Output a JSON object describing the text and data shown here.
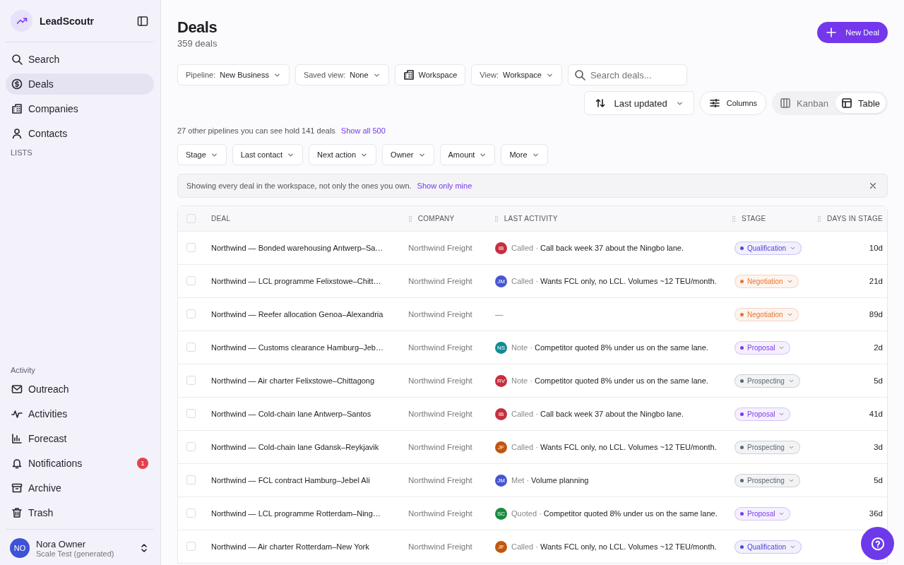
{
  "sidebar": {
    "brand": "LeadScoutr",
    "nav": [
      {
        "label": "Search",
        "selected": false
      },
      {
        "label": "Deals",
        "selected": true
      },
      {
        "label": "Companies",
        "selected": false
      },
      {
        "label": "Contacts",
        "selected": false
      }
    ],
    "lists_heading": "LISTS",
    "activity_heading": "Activity",
    "activity_nav": [
      {
        "label": "Outreach",
        "selected": false
      },
      {
        "label": "Activities",
        "selected": false
      },
      {
        "label": "Forecast",
        "selected": false
      },
      {
        "label": "Notifications",
        "selected": false,
        "badge": "1"
      },
      {
        "label": "Archive",
        "selected": false
      },
      {
        "label": "Trash",
        "selected": false
      }
    ],
    "user": {
      "initials": "NO",
      "name": "Nora Owner",
      "workspace": "Scale Test (generated)"
    }
  },
  "header": {
    "title": "Deals",
    "count": "359 deals",
    "new_button": "New Deal"
  },
  "toolbar": {
    "pipeline": {
      "label": "Pipeline:",
      "value": "New Business"
    },
    "saved_view": {
      "label": "Saved view:",
      "value": "None"
    },
    "workspace_button": "Workspace",
    "view": {
      "label": "View:",
      "value": "Workspace"
    },
    "search": {
      "placeholder": "Search deals..."
    },
    "sort": "Last updated",
    "columns_button": "Columns",
    "view_modes": [
      {
        "label": "Kanban",
        "selected": false
      },
      {
        "label": "Table",
        "selected": true
      }
    ]
  },
  "pipelines_note": {
    "text": "27 other pipelines you can see hold 141 deals",
    "link": "Show all 500"
  },
  "filters": [
    "Stage",
    "Last contact",
    "Next action",
    "Owner",
    "Amount",
    "More"
  ],
  "banner": {
    "text": "Showing every deal in the workspace, not only the ones you own.",
    "link": "Show only mine"
  },
  "table": {
    "all_checked": false,
    "columns": [
      "DEAL",
      "COMPANY",
      "LAST ACTIVITY",
      "STAGE",
      "DAYS IN STAGE"
    ],
    "rows": [
      {
        "checked": false,
        "deal": "Northwind — Bonded warehousing Antwerp–Sa…",
        "company": "Northwind Freight",
        "activity": {
          "initials": "IB",
          "color": "#c62f3e",
          "type": "Called ·",
          "text": "Call back week 37 about the Ningbo lane."
        },
        "stage": {
          "label": "Qualification",
          "color": "#5146d8"
        },
        "days": "10d"
      },
      {
        "checked": false,
        "deal": "Northwind — LCL programme Felixstowe–Chitt…",
        "company": "Northwind Freight",
        "activity": {
          "initials": "JM",
          "color": "#4656d0",
          "type": "Called ·",
          "text": "Wants FCL only, no LCL. Volumes ~12 TEU/month."
        },
        "stage": {
          "label": "Negotiation",
          "color": "#e8772e"
        },
        "days": "21d"
      },
      {
        "checked": false,
        "deal": "Northwind — Reefer allocation Genoa–Alexandria",
        "company": "Northwind Freight",
        "activity": {
          "empty": "—"
        },
        "stage": {
          "label": "Negotiation",
          "color": "#e8772e"
        },
        "days": "89d"
      },
      {
        "checked": false,
        "deal": "Northwind — Customs clearance Hamburg–Jeb…",
        "company": "Northwind Freight",
        "activity": {
          "initials": "NS",
          "color": "#138a94",
          "type": "Note ·",
          "text": "Competitor quoted 8% under us on the same lane."
        },
        "stage": {
          "label": "Proposal",
          "color": "#7b3aed"
        },
        "days": "2d"
      },
      {
        "checked": false,
        "deal": "Northwind — Air charter Felixstowe–Chittagong",
        "company": "Northwind Freight",
        "activity": {
          "initials": "RV",
          "color": "#c62f3e",
          "type": "Note ·",
          "text": "Competitor quoted 8% under us on the same lane."
        },
        "stage": {
          "label": "Prospecting",
          "color": "#5f6672"
        },
        "days": "5d"
      },
      {
        "checked": false,
        "deal": "Northwind — Cold-chain lane Antwerp–Santos",
        "company": "Northwind Freight",
        "activity": {
          "initials": "IB",
          "color": "#c62f3e",
          "type": "Called ·",
          "text": "Call back week 37 about the Ningbo lane."
        },
        "stage": {
          "label": "Proposal",
          "color": "#7b3aed"
        },
        "days": "41d"
      },
      {
        "checked": false,
        "deal": "Northwind — Cold-chain lane Gdansk–Reykjavik",
        "company": "Northwind Freight",
        "activity": {
          "initials": "JF",
          "color": "#c0560f",
          "type": "Called ·",
          "text": "Wants FCL only, no LCL. Volumes ~12 TEU/month."
        },
        "stage": {
          "label": "Prospecting",
          "color": "#5f6672"
        },
        "days": "3d"
      },
      {
        "checked": false,
        "deal": "Northwind — FCL contract Hamburg–Jebel Ali",
        "company": "Northwind Freight",
        "activity": {
          "initials": "JM",
          "color": "#4656d0",
          "type": "Met ·",
          "text": "Volume planning"
        },
        "stage": {
          "label": "Prospecting",
          "color": "#5f6672"
        },
        "days": "5d"
      },
      {
        "checked": false,
        "deal": "Northwind — LCL programme Rotterdam–Ning…",
        "company": "Northwind Freight",
        "activity": {
          "initials": "SC",
          "color": "#178a3e",
          "type": "Quoted ·",
          "text": "Competitor quoted 8% under us on the same lane."
        },
        "stage": {
          "label": "Proposal",
          "color": "#7b3aed"
        },
        "days": "36d"
      },
      {
        "checked": false,
        "deal": "Northwind — Air charter Rotterdam–New York",
        "company": "Northwind Freight",
        "activity": {
          "initials": "JF",
          "color": "#c0560f",
          "type": "Called ·",
          "text": "Wants FCL only, no LCL. Volumes ~12 TEU/month."
        },
        "stage": {
          "label": "Qualification",
          "color": "#5146d8"
        }
      }
    ]
  }
}
